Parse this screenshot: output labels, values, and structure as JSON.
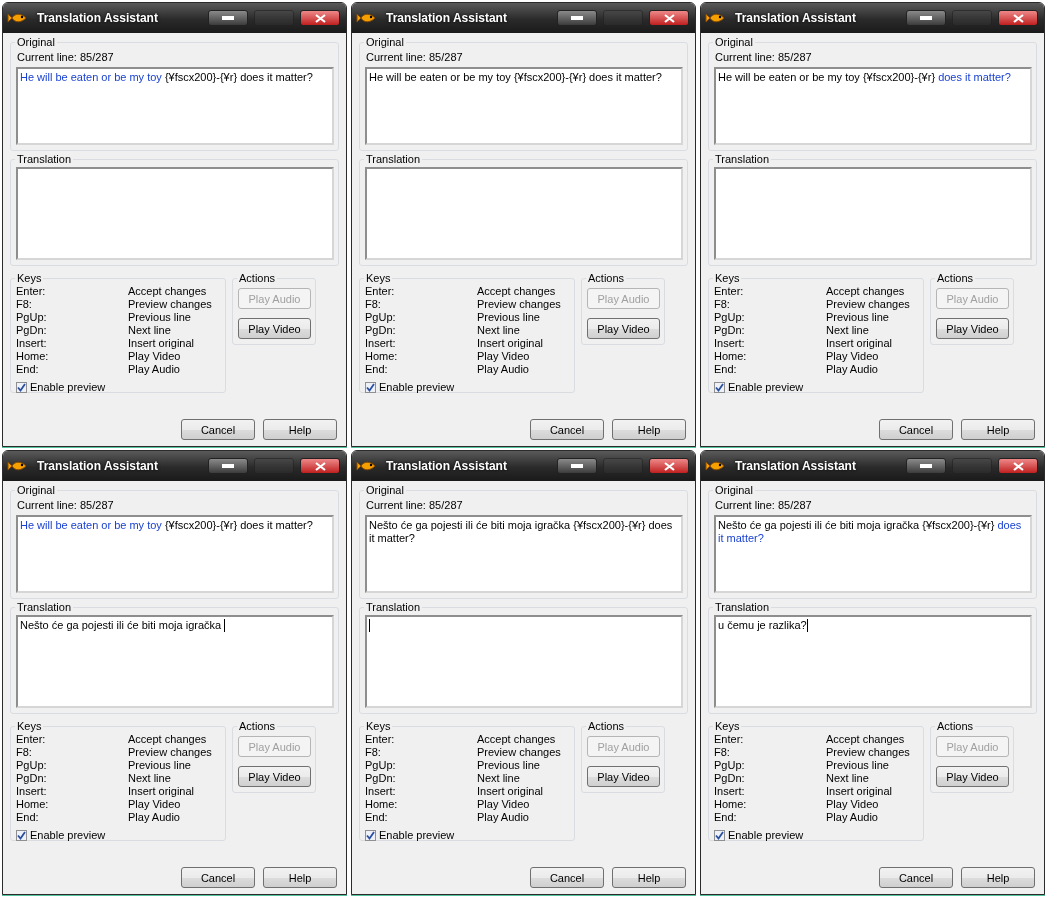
{
  "windows": [
    {
      "title": "Translation Assistant",
      "original_group": "Original",
      "current_line": "Current line: 85/287",
      "original_text": [
        {
          "text": "He will be eaten or be my toy ",
          "highlighted": true
        },
        {
          "text": "{¥fscx200}-{¥r} does it matter?",
          "highlighted": false
        }
      ],
      "translation_group": "Translation",
      "caret": false,
      "keys_group": "Keys",
      "keys": [
        {
          "key": "Enter:",
          "action": "Accept changes"
        },
        {
          "key": "F8:",
          "action": "Preview changes"
        },
        {
          "key": "PgUp:",
          "action": "Previous line"
        },
        {
          "key": "PgDn:",
          "action": "Next line"
        },
        {
          "key": "Insert:",
          "action": "Insert original"
        },
        {
          "key": "Home:",
          "action": "Play Video"
        },
        {
          "key": "End:",
          "action": "Play Audio"
        }
      ],
      "enable_preview": {
        "label": "Enable preview",
        "checked": true
      },
      "actions_group": "Actions",
      "action_buttons": [
        {
          "label": "Play Audio",
          "disabled": true
        },
        {
          "label": "Play Video",
          "disabled": false
        }
      ],
      "buttons": [
        "Cancel",
        "Help"
      ]
    },
    {
      "title": "Translation Assistant",
      "original_group": "Original",
      "current_line": "Current line: 85/287",
      "original_text": [
        {
          "text": "He will be eaten or be my toy {¥fscx200}-{¥r} does it matter?",
          "highlighted": false
        }
      ],
      "translation_group": "Translation",
      "caret": false,
      "keys_group": "Keys",
      "keys": [
        {
          "key": "Enter:",
          "action": "Accept changes"
        },
        {
          "key": "F8:",
          "action": "Preview changes"
        },
        {
          "key": "PgUp:",
          "action": "Previous line"
        },
        {
          "key": "PgDn:",
          "action": "Next line"
        },
        {
          "key": "Insert:",
          "action": "Insert original"
        },
        {
          "key": "Home:",
          "action": "Play Video"
        },
        {
          "key": "End:",
          "action": "Play Audio"
        }
      ],
      "enable_preview": {
        "label": "Enable preview",
        "checked": true
      },
      "actions_group": "Actions",
      "action_buttons": [
        {
          "label": "Play Audio",
          "disabled": true
        },
        {
          "label": "Play Video",
          "disabled": false
        }
      ],
      "buttons": [
        "Cancel",
        "Help"
      ]
    },
    {
      "title": "Translation Assistant",
      "original_group": "Original",
      "current_line": "Current line: 85/287",
      "original_text": [
        {
          "text": "He will be eaten or be my toy {¥fscx200}-{¥r} ",
          "highlighted": false
        },
        {
          "text": "does it matter?",
          "highlighted": true
        }
      ],
      "translation_group": "Translation",
      "caret": false,
      "keys_group": "Keys",
      "keys": [
        {
          "key": "Enter:",
          "action": "Accept changes"
        },
        {
          "key": "F8:",
          "action": "Preview changes"
        },
        {
          "key": "PgUp:",
          "action": "Previous line"
        },
        {
          "key": "PgDn:",
          "action": "Next line"
        },
        {
          "key": "Insert:",
          "action": "Insert original"
        },
        {
          "key": "Home:",
          "action": "Play Video"
        },
        {
          "key": "End:",
          "action": "Play Audio"
        }
      ],
      "enable_preview": {
        "label": "Enable preview",
        "checked": true
      },
      "actions_group": "Actions",
      "action_buttons": [
        {
          "label": "Play Audio",
          "disabled": true
        },
        {
          "label": "Play Video",
          "disabled": false
        }
      ],
      "buttons": [
        "Cancel",
        "Help"
      ]
    },
    {
      "title": "Translation Assistant",
      "original_group": "Original",
      "current_line": "Current line: 85/287",
      "original_text": [
        {
          "text": "He will be eaten or be my toy ",
          "highlighted": true
        },
        {
          "text": "{¥fscx200}-{¥r} does it matter?",
          "highlighted": false
        }
      ],
      "translation_group": "Translation",
      "translation_text": "Nešto će ga pojesti ili će biti moja igračka ",
      "caret": true,
      "keys_group": "Keys",
      "keys": [
        {
          "key": "Enter:",
          "action": "Accept changes"
        },
        {
          "key": "F8:",
          "action": "Preview changes"
        },
        {
          "key": "PgUp:",
          "action": "Previous line"
        },
        {
          "key": "PgDn:",
          "action": "Next line"
        },
        {
          "key": "Insert:",
          "action": "Insert original"
        },
        {
          "key": "Home:",
          "action": "Play Video"
        },
        {
          "key": "End:",
          "action": "Play Audio"
        }
      ],
      "enable_preview": {
        "label": "Enable preview",
        "checked": true
      },
      "actions_group": "Actions",
      "action_buttons": [
        {
          "label": "Play Audio",
          "disabled": true
        },
        {
          "label": "Play Video",
          "disabled": false
        }
      ],
      "buttons": [
        "Cancel",
        "Help"
      ]
    },
    {
      "title": "Translation Assistant",
      "original_group": "Original",
      "current_line": "Current line: 85/287",
      "original_text": [
        {
          "text": "Nešto će ga pojesti ili će biti moja igračka {¥fscx200}-{¥r} does it matter?",
          "highlighted": false
        }
      ],
      "translation_group": "Translation",
      "caret": true,
      "keys_group": "Keys",
      "keys": [
        {
          "key": "Enter:",
          "action": "Accept changes"
        },
        {
          "key": "F8:",
          "action": "Preview changes"
        },
        {
          "key": "PgUp:",
          "action": "Previous line"
        },
        {
          "key": "PgDn:",
          "action": "Next line"
        },
        {
          "key": "Insert:",
          "action": "Insert original"
        },
        {
          "key": "Home:",
          "action": "Play Video"
        },
        {
          "key": "End:",
          "action": "Play Audio"
        }
      ],
      "enable_preview": {
        "label": "Enable preview",
        "checked": true
      },
      "actions_group": "Actions",
      "action_buttons": [
        {
          "label": "Play Audio",
          "disabled": true
        },
        {
          "label": "Play Video",
          "disabled": false
        }
      ],
      "buttons": [
        "Cancel",
        "Help"
      ]
    },
    {
      "title": "Translation Assistant",
      "original_group": "Original",
      "current_line": "Current line: 85/287",
      "original_text": [
        {
          "text": "Nešto će ga pojesti ili će biti moja igračka {¥fscx200}-{¥r} ",
          "highlighted": false
        },
        {
          "text": "does it matter?",
          "highlighted": true
        }
      ],
      "translation_group": "Translation",
      "translation_text": "u čemu je razlika?",
      "caret": true,
      "keys_group": "Keys",
      "keys": [
        {
          "key": "Enter:",
          "action": "Accept changes"
        },
        {
          "key": "F8:",
          "action": "Preview changes"
        },
        {
          "key": "PgUp:",
          "action": "Previous line"
        },
        {
          "key": "PgDn:",
          "action": "Next line"
        },
        {
          "key": "Insert:",
          "action": "Insert original"
        },
        {
          "key": "Home:",
          "action": "Play Video"
        },
        {
          "key": "End:",
          "action": "Play Audio"
        }
      ],
      "enable_preview": {
        "label": "Enable preview",
        "checked": true
      },
      "actions_group": "Actions",
      "action_buttons": [
        {
          "label": "Play Audio",
          "disabled": true
        },
        {
          "label": "Play Video",
          "disabled": false
        }
      ],
      "buttons": [
        "Cancel",
        "Help"
      ]
    }
  ]
}
